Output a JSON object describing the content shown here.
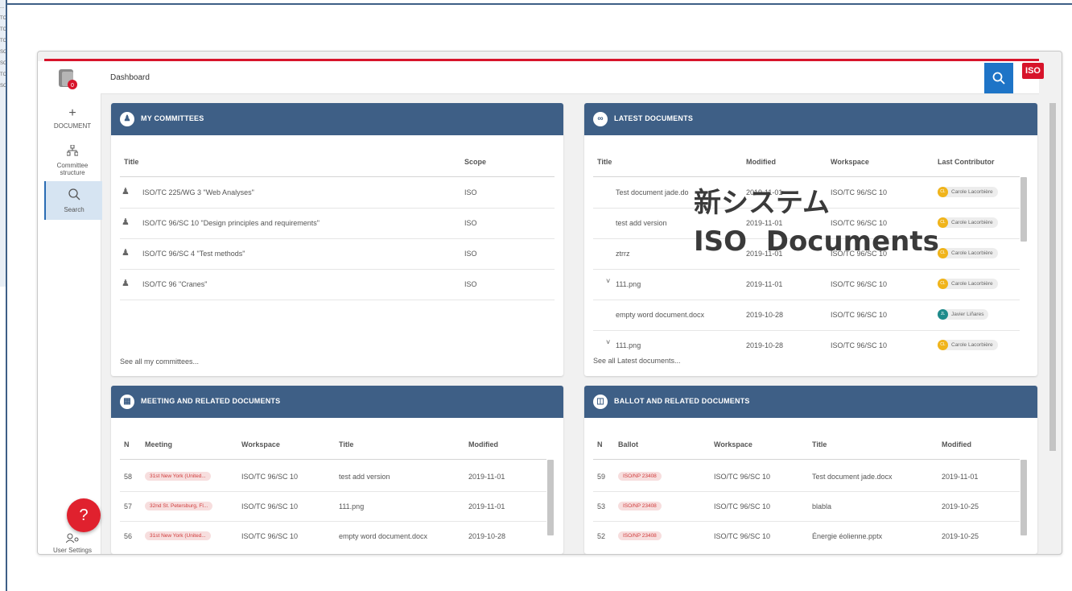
{
  "sidebar_nav": {
    "document": "DOCUMENT",
    "committee_structure": "Committee structure",
    "search": "Search",
    "help": "?",
    "user_settings": "User Settings"
  },
  "header": {
    "breadcrumb": "Dashboard",
    "logo_text": "ISO"
  },
  "overlay": {
    "line1": "新システム",
    "line2": "ISO  Documents"
  },
  "my_committees": {
    "title": "MY COMMITTEES",
    "headers": [
      "Title",
      "Scope"
    ],
    "rows": [
      {
        "title": "ISO/TC 225/WG 3 \"Web Analyses\"",
        "scope": "ISO"
      },
      {
        "title": "ISO/TC 96/SC 10 \"Design principles and requirements\"",
        "scope": "ISO"
      },
      {
        "title": "ISO/TC 96/SC 4 \"Test methods\"",
        "scope": "ISO"
      },
      {
        "title": "ISO/TC 96 \"Cranes\"",
        "scope": "ISO"
      }
    ],
    "footer": "See all my committees..."
  },
  "latest_documents": {
    "title": "LATEST DOCUMENTS",
    "headers": [
      "Title",
      "Modified",
      "Workspace",
      "Last Contributor"
    ],
    "rows": [
      {
        "title": "Test document jade.do",
        "modified": "2019-11-01",
        "workspace": "ISO/TC 96/SC 10",
        "contributor": "Carole Lacorbière",
        "initials": "CL",
        "color": "#f0b41b"
      },
      {
        "title": "test add version",
        "modified": "2019-11-01",
        "workspace": "ISO/TC 96/SC 10",
        "contributor": "Carole Lacorbière",
        "initials": "CL",
        "color": "#f0b41b"
      },
      {
        "title": "ztrrz",
        "modified": "2019-11-01",
        "workspace": "ISO/TC 96/SC 10",
        "contributor": "Carole Lacorbière",
        "initials": "CL",
        "color": "#f0b41b"
      },
      {
        "title": "111.png",
        "modified": "2019-11-01",
        "workspace": "ISO/TC 96/SC 10",
        "contributor": "Carole Lacorbière",
        "initials": "CL",
        "color": "#f0b41b"
      },
      {
        "title": "empty word document.docx",
        "modified": "2019-10-28",
        "workspace": "ISO/TC 96/SC 10",
        "contributor": "Javier Liñares",
        "initials": "JL",
        "color": "#1e8a8a"
      },
      {
        "title": "111.png",
        "modified": "2019-10-28",
        "workspace": "ISO/TC 96/SC 10",
        "contributor": "Carole Lacorbière",
        "initials": "CL",
        "color": "#f0b41b"
      }
    ],
    "footer": "See all Latest documents..."
  },
  "meetings": {
    "title": "MEETING AND RELATED DOCUMENTS",
    "headers": [
      "N",
      "Meeting",
      "Workspace",
      "Title",
      "Modified"
    ],
    "rows": [
      {
        "n": "58",
        "meeting": "31st New York (United...",
        "workspace": "ISO/TC 96/SC 10",
        "title": "test add version",
        "modified": "2019-11-01"
      },
      {
        "n": "57",
        "meeting": "32nd St. Petersburg, Fl...",
        "workspace": "ISO/TC 96/SC 10",
        "title": "111.png",
        "modified": "2019-11-01"
      },
      {
        "n": "56",
        "meeting": "31st New York (United...",
        "workspace": "ISO/TC 96/SC 10",
        "title": "empty word document.docx",
        "modified": "2019-10-28"
      }
    ]
  },
  "ballots": {
    "title": "BALLOT AND RELATED DOCUMENTS",
    "headers": [
      "N",
      "Ballot",
      "Workspace",
      "Title",
      "Modified"
    ],
    "rows": [
      {
        "n": "59",
        "ballot": "ISO/NP 23408",
        "workspace": "ISO/TC 96/SC 10",
        "title": "Test document jade.docx",
        "modified": "2019-11-01"
      },
      {
        "n": "53",
        "ballot": "ISO/NP 23408",
        "workspace": "ISO/TC 96/SC 10",
        "title": "blabla",
        "modified": "2019-10-25"
      },
      {
        "n": "52",
        "ballot": "ISO/NP 23408",
        "workspace": "ISO/TC 96/SC 10",
        "title": "Énergie éolienne.pptx",
        "modified": "2019-10-25"
      }
    ]
  }
}
